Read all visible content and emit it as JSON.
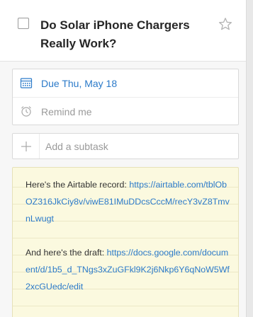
{
  "task": {
    "title": "Do Solar iPhone Chargers Really Work?",
    "starred": false
  },
  "due": {
    "label": "Due Thu, May 18",
    "icon": "calendar-icon"
  },
  "reminder": {
    "label": "Remind me",
    "icon": "alarm-clock-icon"
  },
  "subtask": {
    "placeholder": "Add a subtask",
    "icon": "plus-icon"
  },
  "note": {
    "para1_text": "Here's the Airtable record: ",
    "para1_link": "https://airtable.com/tblObOZ316JkCiy8v/viwE81IMuDDcsCccM/recY3vZ8TmvnLwugt",
    "para2_text": "And here's the draft: ",
    "para2_link": "https://docs.google.com/document/d/1b5_d_TNgs3xZuGFkl9K2j6Nkp6Y6qNoW5Wf2xcGUedc/edit"
  },
  "colors": {
    "accent": "#2b7ac9",
    "note_bg": "#fbf9df"
  }
}
